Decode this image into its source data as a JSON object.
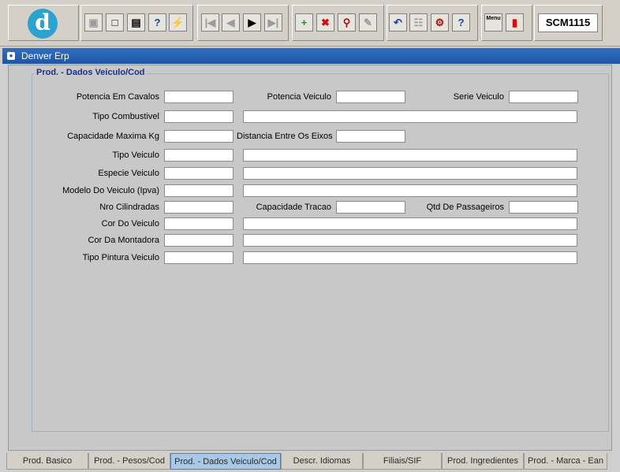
{
  "toolbar": {
    "logo_letter": "d",
    "groups": [
      {
        "name": "file",
        "buttons": [
          "save-icon",
          "window-icon",
          "print-icon",
          "query-icon",
          "execute-icon"
        ]
      },
      {
        "name": "nav",
        "buttons": [
          "first-record-icon",
          "prev-record-icon",
          "next-record-icon",
          "last-record-icon"
        ]
      },
      {
        "name": "edit",
        "buttons": [
          "insert-record-icon",
          "delete-record-icon",
          "find-icon",
          "clear-icon"
        ]
      },
      {
        "name": "tools",
        "buttons": [
          "undo-icon",
          "clipboard-icon",
          "tools-icon",
          "help-icon"
        ]
      },
      {
        "name": "app",
        "buttons": [
          "menu-icon",
          "exit-icon"
        ]
      }
    ],
    "menu_icon_text": "Menu",
    "form_code": "SCM1115"
  },
  "window": {
    "title": "Denver Erp"
  },
  "form": {
    "section_title": "Prod. - Dados Veiculo/Cod",
    "labels": {
      "potencia_cavalos": "Potencia Em Cavalos",
      "potencia_veiculo": "Potencia Veiculo",
      "serie_veiculo": "Serie Veiculo",
      "tipo_combustivel": "Tipo Combustivel",
      "capacidade_maxima": "Capacidade Maxima Kg",
      "distancia_eixos": "Distancia Entre Os Eixos",
      "tipo_veiculo": "Tipo Veiculo",
      "especie_veiculo": "Especie Veiculo",
      "modelo_veiculo": "Modelo Do Veiculo (Ipva)",
      "nro_cilindradas": "Nro Cilindradas",
      "capacidade_tracao": "Capacidade Tracao",
      "qtd_passageiros": "Qtd De Passageiros",
      "cor_veiculo": "Cor Do Veiculo",
      "cor_montadora": "Cor Da Montadora",
      "tipo_pintura": "Tipo Pintura Veiculo"
    },
    "values": {
      "potencia_cavalos": "",
      "potencia_veiculo": "",
      "serie_veiculo": "",
      "tipo_combustivel_cod": "",
      "tipo_combustivel_desc": "",
      "capacidade_maxima": "",
      "distancia_eixos": "",
      "tipo_veiculo_cod": "",
      "tipo_veiculo_desc": "",
      "especie_veiculo_cod": "",
      "especie_veiculo_desc": "",
      "modelo_veiculo_cod": "",
      "modelo_veiculo_desc": "",
      "nro_cilindradas": "",
      "capacidade_tracao": "",
      "qtd_passageiros": "",
      "cor_veiculo_cod": "",
      "cor_veiculo_desc": "",
      "cor_montadora_cod": "",
      "cor_montadora_desc": "",
      "tipo_pintura_cod": "",
      "tipo_pintura_desc": ""
    }
  },
  "tabs": [
    {
      "label": "Prod. Basico",
      "active": false
    },
    {
      "label": "Prod. - Pesos/Cod",
      "active": false
    },
    {
      "label": "Prod. - Dados Veiculo/Cod",
      "active": true
    },
    {
      "label": "Descr. Idiomas",
      "active": false
    },
    {
      "label": "Filiais/SIF",
      "active": false
    },
    {
      "label": "Prod. Ingredientes",
      "active": false
    },
    {
      "label": "Prod. - Marca - Ean",
      "active": false
    }
  ],
  "colors": {
    "titlebar": "#1e56a8",
    "section_title": "#1a2f8c",
    "active_tab": "#a9c8e6"
  }
}
